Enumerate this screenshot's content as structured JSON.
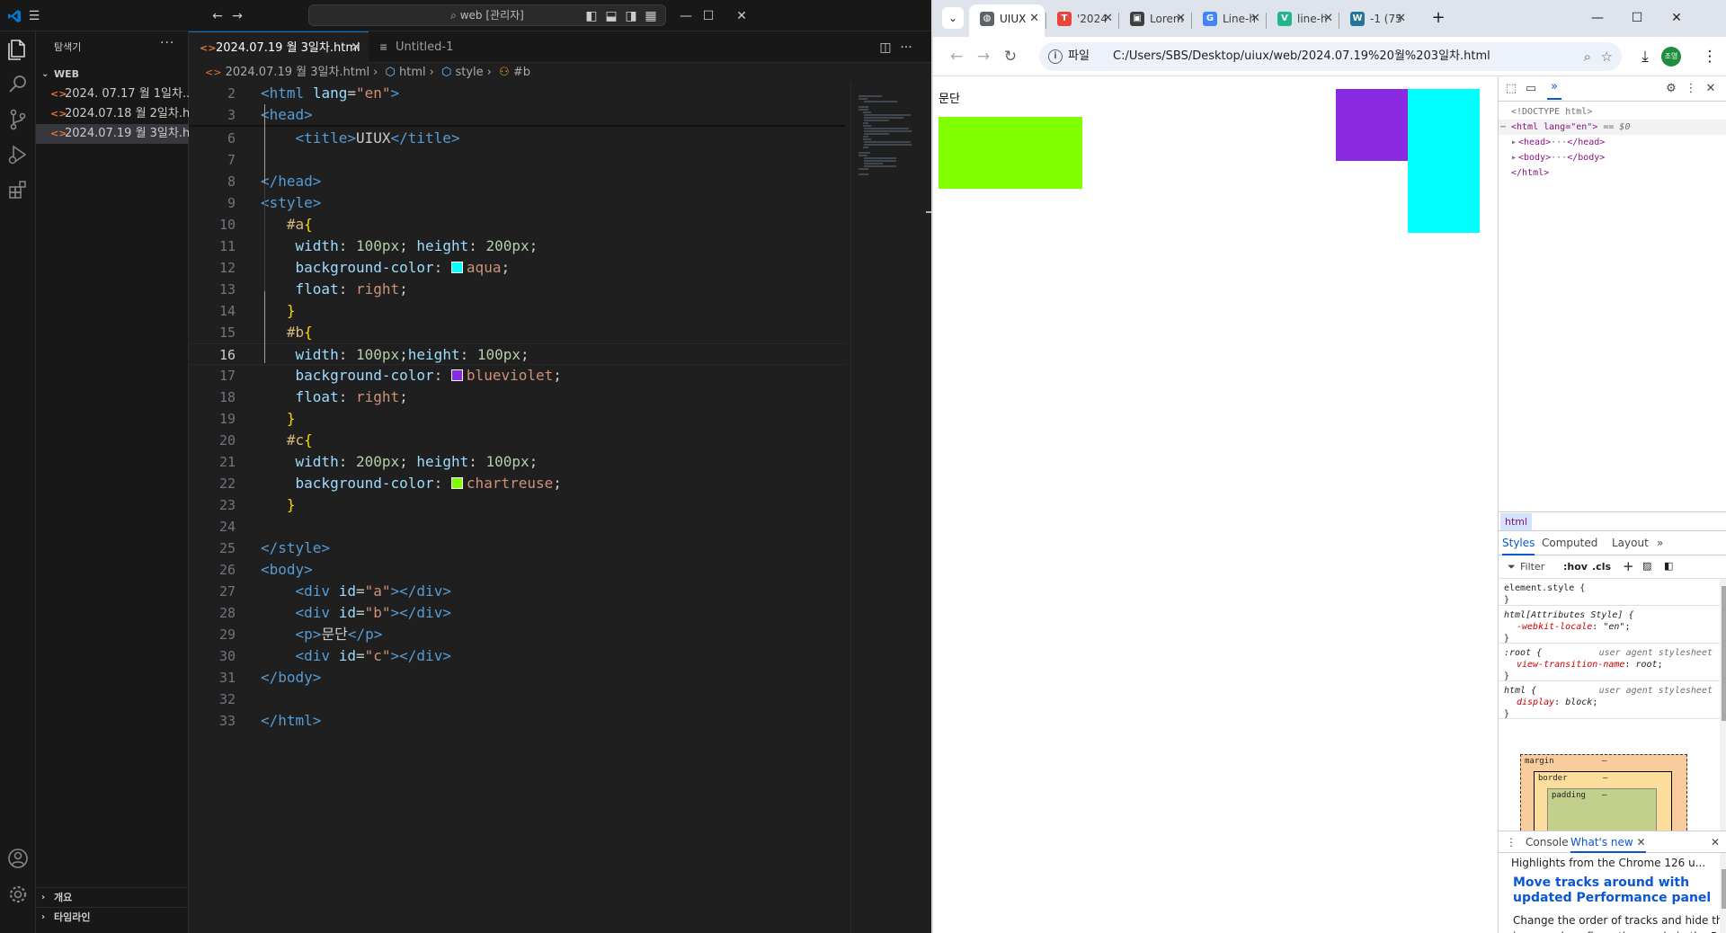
{
  "vscode": {
    "search_text": "web [관리자]",
    "explorer_title": "탐색기",
    "workspace_name": "WEB",
    "files": [
      {
        "name": "2024. 07.17 월 1일차....",
        "selected": false
      },
      {
        "name": "2024.07.18 월 2일차.h...",
        "selected": false
      },
      {
        "name": "2024.07.19 월 3일차.h...",
        "selected": true
      }
    ],
    "outline_label": "개요",
    "timeline_label": "타임라인",
    "tabs": [
      {
        "label": "2024.07.19 월 3일차.html",
        "active": true
      },
      {
        "label": "Untitled-1",
        "active": false
      }
    ],
    "breadcrumb": [
      "2024.07.19 월 3일차.html",
      "html",
      "style",
      "#b"
    ],
    "current_line": 16,
    "code_lines": [
      {
        "n": 2,
        "text": "<html lang=\"en\">"
      },
      {
        "n": 3,
        "text": "<head>"
      },
      {
        "n": 6,
        "text": "    <title>UIUX</title>"
      },
      {
        "n": 7,
        "text": ""
      },
      {
        "n": 8,
        "text": "</head>"
      },
      {
        "n": 9,
        "text": "<style>"
      },
      {
        "n": 10,
        "text": "   #a{"
      },
      {
        "n": 11,
        "text": "    width: 100px; height: 200px;"
      },
      {
        "n": 12,
        "text": "    background-color: aqua;"
      },
      {
        "n": 13,
        "text": "    float: right;"
      },
      {
        "n": 14,
        "text": "   }"
      },
      {
        "n": 15,
        "text": "   #b{"
      },
      {
        "n": 16,
        "text": "    width: 100px;height: 100px;"
      },
      {
        "n": 17,
        "text": "    background-color: blueviolet;"
      },
      {
        "n": 18,
        "text": "    float: right;"
      },
      {
        "n": 19,
        "text": "   }"
      },
      {
        "n": 20,
        "text": "   #c{"
      },
      {
        "n": 21,
        "text": "    width: 200px; height: 100px;"
      },
      {
        "n": 22,
        "text": "    background-color: chartreuse;"
      },
      {
        "n": 23,
        "text": "   }"
      },
      {
        "n": 24,
        "text": ""
      },
      {
        "n": 25,
        "text": "</style>"
      },
      {
        "n": 26,
        "text": "<body>"
      },
      {
        "n": 27,
        "text": "    <div id=\"a\"></div>"
      },
      {
        "n": 28,
        "text": "    <div id=\"b\"></div>"
      },
      {
        "n": 29,
        "text": "    <p>문단</p>"
      },
      {
        "n": 30,
        "text": "    <div id=\"c\"></div>"
      },
      {
        "n": 31,
        "text": "</body>"
      },
      {
        "n": 32,
        "text": ""
      },
      {
        "n": 33,
        "text": "</html>"
      }
    ]
  },
  "chrome": {
    "tabs": [
      {
        "label": "UIUX",
        "active": true,
        "fav_color": "#5f6368",
        "fav_glyph": "◍"
      },
      {
        "label": "'2024",
        "active": false,
        "fav_color": "#e8453c",
        "fav_glyph": "T"
      },
      {
        "label": "Lorem",
        "active": false,
        "fav_color": "#3c4043",
        "fav_glyph": "▣"
      },
      {
        "label": "Line-h",
        "active": false,
        "fav_color": "#4285f4",
        "fav_glyph": "G"
      },
      {
        "label": "line-h",
        "active": false,
        "fav_color": "#20b78e",
        "fav_glyph": "V"
      },
      {
        "label": "-1 (75",
        "active": false,
        "fav_color": "#21759b",
        "fav_glyph": "W"
      }
    ],
    "address_chip": "파일",
    "url": "C:/Users/SBS/Desktop/uiux/web/2024.07.19%20월%203일차.html",
    "profile_initials": "조영",
    "page": {
      "paragraph": "문단",
      "colors": {
        "a": "#00ffff",
        "b": "#8a2be2",
        "c": "#7fff00"
      }
    }
  },
  "devtools": {
    "elements": {
      "doctype": "<!DOCTYPE html>",
      "html_open": "<html lang=\"en\">",
      "selected_marker": "== $0",
      "head": "<head>",
      "head_close": "</head>",
      "body": "<body>",
      "body_close": "</body>",
      "html_close": "</html>"
    },
    "crumb": "html",
    "subtabs": [
      "Styles",
      "Computed",
      "Layout"
    ],
    "filter_placeholder": "Filter",
    "hov": ":hov",
    "cls": ".cls",
    "rules": [
      {
        "selector": "element.style {",
        "source": "",
        "props": []
      },
      {
        "selector": "html[Attributes Style] {",
        "source": "",
        "props": [
          {
            "name": "-webkit-locale",
            "value": "\"en\""
          }
        ]
      },
      {
        "selector": ":root {",
        "source": "user agent stylesheet",
        "props": [
          {
            "name": "view-transition-name",
            "value": "root"
          }
        ]
      },
      {
        "selector": "html {",
        "source": "user agent stylesheet",
        "props": [
          {
            "name": "display",
            "value": "block"
          }
        ]
      }
    ],
    "boxmodel": {
      "margin": "margin",
      "border": "border",
      "padding": "padding",
      "dash": "–"
    },
    "drawer_tabs": [
      "Console",
      "What's new"
    ],
    "whats_new_subtitle": "Highlights from the Chrome 126 u...",
    "whats_new_title": "Move tracks around with updated Performance panel",
    "whats_new_body": "Change the order of tracks and hide th improved configuration mode in the Pe panel."
  }
}
